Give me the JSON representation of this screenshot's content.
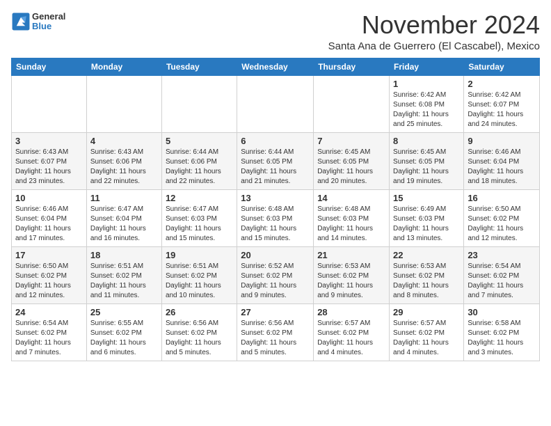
{
  "header": {
    "logo_line1": "General",
    "logo_line2": "Blue",
    "month": "November 2024",
    "location": "Santa Ana de Guerrero (El Cascabel), Mexico"
  },
  "weekdays": [
    "Sunday",
    "Monday",
    "Tuesday",
    "Wednesday",
    "Thursday",
    "Friday",
    "Saturday"
  ],
  "weeks": [
    [
      {
        "day": "",
        "info": ""
      },
      {
        "day": "",
        "info": ""
      },
      {
        "day": "",
        "info": ""
      },
      {
        "day": "",
        "info": ""
      },
      {
        "day": "",
        "info": ""
      },
      {
        "day": "1",
        "info": "Sunrise: 6:42 AM\nSunset: 6:08 PM\nDaylight: 11 hours\nand 25 minutes."
      },
      {
        "day": "2",
        "info": "Sunrise: 6:42 AM\nSunset: 6:07 PM\nDaylight: 11 hours\nand 24 minutes."
      }
    ],
    [
      {
        "day": "3",
        "info": "Sunrise: 6:43 AM\nSunset: 6:07 PM\nDaylight: 11 hours\nand 23 minutes."
      },
      {
        "day": "4",
        "info": "Sunrise: 6:43 AM\nSunset: 6:06 PM\nDaylight: 11 hours\nand 22 minutes."
      },
      {
        "day": "5",
        "info": "Sunrise: 6:44 AM\nSunset: 6:06 PM\nDaylight: 11 hours\nand 22 minutes."
      },
      {
        "day": "6",
        "info": "Sunrise: 6:44 AM\nSunset: 6:05 PM\nDaylight: 11 hours\nand 21 minutes."
      },
      {
        "day": "7",
        "info": "Sunrise: 6:45 AM\nSunset: 6:05 PM\nDaylight: 11 hours\nand 20 minutes."
      },
      {
        "day": "8",
        "info": "Sunrise: 6:45 AM\nSunset: 6:05 PM\nDaylight: 11 hours\nand 19 minutes."
      },
      {
        "day": "9",
        "info": "Sunrise: 6:46 AM\nSunset: 6:04 PM\nDaylight: 11 hours\nand 18 minutes."
      }
    ],
    [
      {
        "day": "10",
        "info": "Sunrise: 6:46 AM\nSunset: 6:04 PM\nDaylight: 11 hours\nand 17 minutes."
      },
      {
        "day": "11",
        "info": "Sunrise: 6:47 AM\nSunset: 6:04 PM\nDaylight: 11 hours\nand 16 minutes."
      },
      {
        "day": "12",
        "info": "Sunrise: 6:47 AM\nSunset: 6:03 PM\nDaylight: 11 hours\nand 15 minutes."
      },
      {
        "day": "13",
        "info": "Sunrise: 6:48 AM\nSunset: 6:03 PM\nDaylight: 11 hours\nand 15 minutes."
      },
      {
        "day": "14",
        "info": "Sunrise: 6:48 AM\nSunset: 6:03 PM\nDaylight: 11 hours\nand 14 minutes."
      },
      {
        "day": "15",
        "info": "Sunrise: 6:49 AM\nSunset: 6:03 PM\nDaylight: 11 hours\nand 13 minutes."
      },
      {
        "day": "16",
        "info": "Sunrise: 6:50 AM\nSunset: 6:02 PM\nDaylight: 11 hours\nand 12 minutes."
      }
    ],
    [
      {
        "day": "17",
        "info": "Sunrise: 6:50 AM\nSunset: 6:02 PM\nDaylight: 11 hours\nand 12 minutes."
      },
      {
        "day": "18",
        "info": "Sunrise: 6:51 AM\nSunset: 6:02 PM\nDaylight: 11 hours\nand 11 minutes."
      },
      {
        "day": "19",
        "info": "Sunrise: 6:51 AM\nSunset: 6:02 PM\nDaylight: 11 hours\nand 10 minutes."
      },
      {
        "day": "20",
        "info": "Sunrise: 6:52 AM\nSunset: 6:02 PM\nDaylight: 11 hours\nand 9 minutes."
      },
      {
        "day": "21",
        "info": "Sunrise: 6:53 AM\nSunset: 6:02 PM\nDaylight: 11 hours\nand 9 minutes."
      },
      {
        "day": "22",
        "info": "Sunrise: 6:53 AM\nSunset: 6:02 PM\nDaylight: 11 hours\nand 8 minutes."
      },
      {
        "day": "23",
        "info": "Sunrise: 6:54 AM\nSunset: 6:02 PM\nDaylight: 11 hours\nand 7 minutes."
      }
    ],
    [
      {
        "day": "24",
        "info": "Sunrise: 6:54 AM\nSunset: 6:02 PM\nDaylight: 11 hours\nand 7 minutes."
      },
      {
        "day": "25",
        "info": "Sunrise: 6:55 AM\nSunset: 6:02 PM\nDaylight: 11 hours\nand 6 minutes."
      },
      {
        "day": "26",
        "info": "Sunrise: 6:56 AM\nSunset: 6:02 PM\nDaylight: 11 hours\nand 5 minutes."
      },
      {
        "day": "27",
        "info": "Sunrise: 6:56 AM\nSunset: 6:02 PM\nDaylight: 11 hours\nand 5 minutes."
      },
      {
        "day": "28",
        "info": "Sunrise: 6:57 AM\nSunset: 6:02 PM\nDaylight: 11 hours\nand 4 minutes."
      },
      {
        "day": "29",
        "info": "Sunrise: 6:57 AM\nSunset: 6:02 PM\nDaylight: 11 hours\nand 4 minutes."
      },
      {
        "day": "30",
        "info": "Sunrise: 6:58 AM\nSunset: 6:02 PM\nDaylight: 11 hours\nand 3 minutes."
      }
    ]
  ]
}
